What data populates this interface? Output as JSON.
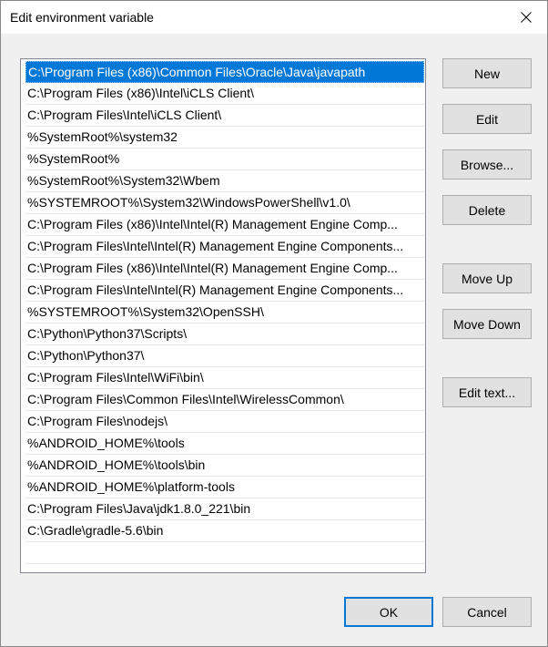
{
  "window": {
    "title": "Edit environment variable"
  },
  "list": {
    "items": [
      "C:\\Program Files (x86)\\Common Files\\Oracle\\Java\\javapath",
      "C:\\Program Files (x86)\\Intel\\iCLS Client\\",
      "C:\\Program Files\\Intel\\iCLS Client\\",
      "%SystemRoot%\\system32",
      "%SystemRoot%",
      "%SystemRoot%\\System32\\Wbem",
      "%SYSTEMROOT%\\System32\\WindowsPowerShell\\v1.0\\",
      "C:\\Program Files (x86)\\Intel\\Intel(R) Management Engine Comp...",
      "C:\\Program Files\\Intel\\Intel(R) Management Engine Components...",
      "C:\\Program Files (x86)\\Intel\\Intel(R) Management Engine Comp...",
      "C:\\Program Files\\Intel\\Intel(R) Management Engine Components...",
      "%SYSTEMROOT%\\System32\\OpenSSH\\",
      "C:\\Python\\Python37\\Scripts\\",
      "C:\\Python\\Python37\\",
      "C:\\Program Files\\Intel\\WiFi\\bin\\",
      "C:\\Program Files\\Common Files\\Intel\\WirelessCommon\\",
      "C:\\Program Files\\nodejs\\",
      "%ANDROID_HOME%\\tools",
      "%ANDROID_HOME%\\tools\\bin",
      "%ANDROID_HOME%\\platform-tools",
      "C:\\Program Files\\Java\\jdk1.8.0_221\\bin",
      "C:\\Gradle\\gradle-5.6\\bin"
    ],
    "selected_index": 0
  },
  "buttons": {
    "new": "New",
    "edit": "Edit",
    "browse": "Browse...",
    "delete": "Delete",
    "move_up": "Move Up",
    "move_down": "Move Down",
    "edit_text": "Edit text...",
    "ok": "OK",
    "cancel": "Cancel"
  },
  "colors": {
    "selection": "#0078d7",
    "dialog_bg": "#f0f0f0",
    "button_bg": "#e1e1e1"
  },
  "icons": {
    "close": "close-icon"
  }
}
